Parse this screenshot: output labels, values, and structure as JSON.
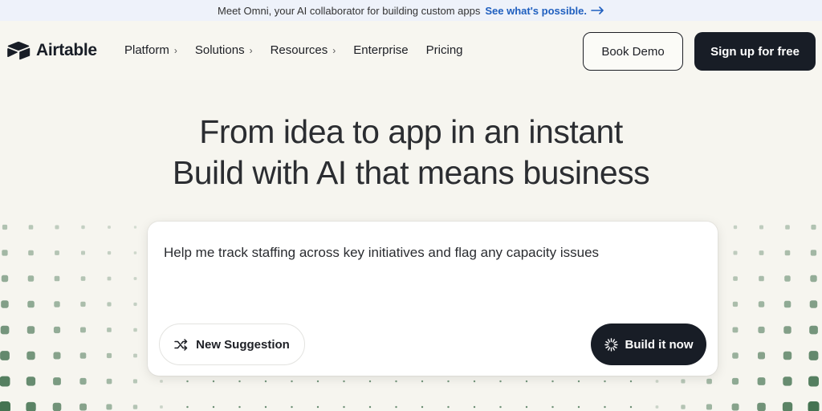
{
  "announcement": {
    "text": "Meet Omni, your AI collaborator for building custom apps",
    "link_label": "See what's possible.",
    "link_icon": "arrow-right-icon"
  },
  "header": {
    "logo_text": "Airtable",
    "nav": [
      {
        "label": "Platform",
        "has_chevron": true
      },
      {
        "label": "Solutions",
        "has_chevron": true
      },
      {
        "label": "Resources",
        "has_chevron": true
      },
      {
        "label": "Enterprise",
        "has_chevron": false
      },
      {
        "label": "Pricing",
        "has_chevron": false
      }
    ],
    "book_demo_label": "Book Demo",
    "signup_label": "Sign up for free"
  },
  "hero": {
    "line1": "From idea to app in an instant",
    "line2": "Build with AI that means business"
  },
  "prompt_card": {
    "prompt_text": "Help me track staffing across key initiatives and flag any capacity issues",
    "suggestion_label": "New Suggestion",
    "suggestion_icon": "shuffle-icon",
    "build_label": "Build it now",
    "build_icon": "sparkle-loader-icon"
  },
  "colors": {
    "background": "#f6f5ef",
    "announcement_bg": "#eef2fa",
    "link": "#1f5fbf",
    "primary_button": "#181d26",
    "dot_pattern": "#3f6e4c"
  }
}
